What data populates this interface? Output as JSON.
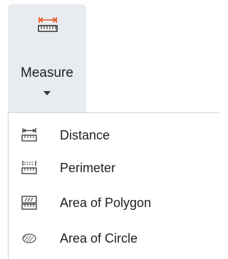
{
  "ribbon": {
    "label": "Measure",
    "icon": "ruler-measure-icon",
    "accent_color": "#e8531f"
  },
  "menu": {
    "items": [
      {
        "label": "Distance",
        "icon": "ruler-distance-icon"
      },
      {
        "label": "Perimeter",
        "icon": "ruler-perimeter-icon"
      },
      {
        "label": "Area of Polygon",
        "icon": "polygon-area-icon"
      },
      {
        "label": "Area of Circle",
        "icon": "circle-area-icon"
      }
    ]
  }
}
